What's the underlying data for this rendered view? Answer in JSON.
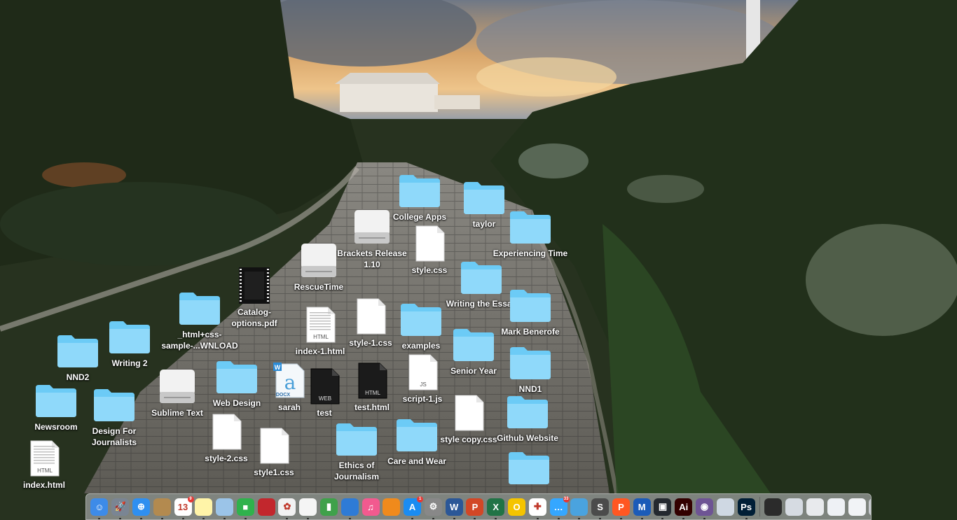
{
  "desktop_icons": [
    {
      "name": "College Apps",
      "kind": "folder"
    },
    {
      "name": "taylor",
      "kind": "folder"
    },
    {
      "name": "Experiencing Time",
      "kind": "folder"
    },
    {
      "name": "Brackets Release 1.10",
      "kind": "drive"
    },
    {
      "name": "style.css",
      "kind": "file"
    },
    {
      "name": "RescueTime",
      "kind": "drive"
    },
    {
      "name": "Writing the Essay",
      "kind": "folder"
    },
    {
      "name": "Catalog-options.pdf",
      "kind": "pdf"
    },
    {
      "name": "_html+css-sample-...WNLOAD",
      "kind": "folder"
    },
    {
      "name": "index-1.html",
      "kind": "html"
    },
    {
      "name": "style-1.css",
      "kind": "file"
    },
    {
      "name": "examples",
      "kind": "folder"
    },
    {
      "name": "Mark Benerofe",
      "kind": "folder"
    },
    {
      "name": "Writing 2",
      "kind": "folder"
    },
    {
      "name": "NND2",
      "kind": "folder"
    },
    {
      "name": "Senior Year",
      "kind": "folder"
    },
    {
      "name": "Web Design",
      "kind": "folder"
    },
    {
      "name": "sarah",
      "kind": "docx"
    },
    {
      "name": "test",
      "kind": "web"
    },
    {
      "name": "test.html",
      "kind": "htmldark"
    },
    {
      "name": "script-1.js",
      "kind": "js"
    },
    {
      "name": "NND1",
      "kind": "folder"
    },
    {
      "name": "Sublime Text",
      "kind": "drive"
    },
    {
      "name": "Newsroom",
      "kind": "folder"
    },
    {
      "name": "Design For Journalists",
      "kind": "folder"
    },
    {
      "name": "style copy.css",
      "kind": "file"
    },
    {
      "name": "Github Website",
      "kind": "folder"
    },
    {
      "name": "style-2.css",
      "kind": "file"
    },
    {
      "name": "style1.css",
      "kind": "file"
    },
    {
      "name": "Ethics of Journalism",
      "kind": "folder"
    },
    {
      "name": "Care and Wear",
      "kind": "folder"
    },
    {
      "name": "index.html",
      "kind": "html"
    },
    {
      "name": "",
      "kind": "folder"
    }
  ],
  "file_badges": {
    "html": "HTML",
    "js": "JS",
    "web": "WEB",
    "docx": "DOCX",
    "docx_letter": "W"
  },
  "dock": {
    "apps": [
      {
        "name": "finder",
        "color": "#3d8be8",
        "glyph": "☺"
      },
      {
        "name": "launchpad",
        "color": "#7a8593",
        "glyph": "🚀"
      },
      {
        "name": "safari",
        "color": "#2f8ff0",
        "glyph": "⊕"
      },
      {
        "name": "contacts",
        "color": "#b38a4f",
        "glyph": ""
      },
      {
        "name": "calendar",
        "color": "#ffffff",
        "glyph": "13",
        "badge": "9"
      },
      {
        "name": "notes",
        "color": "#fff4a8",
        "glyph": ""
      },
      {
        "name": "preview",
        "color": "#9bc4e8",
        "glyph": ""
      },
      {
        "name": "facetime",
        "color": "#2fb24c",
        "glyph": "■"
      },
      {
        "name": "photo-booth",
        "color": "#c2272d",
        "glyph": ""
      },
      {
        "name": "photos",
        "color": "#f2f2f2",
        "glyph": "✿"
      },
      {
        "name": "textedit",
        "color": "#f5f5f5",
        "glyph": ""
      },
      {
        "name": "numbers",
        "color": "#3fa14a",
        "glyph": "▮"
      },
      {
        "name": "keynote",
        "color": "#2e7bd6",
        "glyph": ""
      },
      {
        "name": "itunes",
        "color": "#f25a8f",
        "glyph": "♫"
      },
      {
        "name": "ibooks",
        "color": "#f08a1c",
        "glyph": ""
      },
      {
        "name": "app-store",
        "color": "#1a8cf2",
        "glyph": "A",
        "badge": "1"
      },
      {
        "name": "system-preferences",
        "color": "#888888",
        "glyph": "⚙"
      },
      {
        "name": "word",
        "color": "#2b5797",
        "glyph": "W"
      },
      {
        "name": "powerpoint",
        "color": "#d24726",
        "glyph": "P"
      },
      {
        "name": "excel",
        "color": "#217346",
        "glyph": "X"
      },
      {
        "name": "norton",
        "color": "#f5c400",
        "glyph": "O"
      },
      {
        "name": "first-aid",
        "color": "#ffffff",
        "glyph": "✚"
      },
      {
        "name": "messages",
        "color": "#35a7ff",
        "glyph": "…",
        "badge": "33"
      },
      {
        "name": "network",
        "color": "#4aa3df",
        "glyph": ""
      },
      {
        "name": "sublime-text",
        "color": "#4b4b4b",
        "glyph": "S"
      },
      {
        "name": "pages-p",
        "color": "#ff5722",
        "glyph": "P"
      },
      {
        "name": "malwarebytes",
        "color": "#1b5bb8",
        "glyph": "M"
      },
      {
        "name": "brackets",
        "color": "#24292f",
        "glyph": "▣"
      },
      {
        "name": "illustrator",
        "color": "#330000",
        "glyph": "Ai"
      },
      {
        "name": "github-desktop",
        "color": "#6e5494",
        "glyph": "◉"
      },
      {
        "name": "image-capture",
        "color": "#cfd8e3",
        "glyph": ""
      },
      {
        "name": "photoshop",
        "color": "#001e36",
        "glyph": "Ps"
      },
      {
        "name": "terminal",
        "color": "#2b2b2b",
        "glyph": ""
      },
      {
        "name": "screenshot-1",
        "color": "#d6dbe2",
        "glyph": ""
      },
      {
        "name": "screenshot-2",
        "color": "#e8eaed",
        "glyph": ""
      },
      {
        "name": "screenshot-3",
        "color": "#eef1f5",
        "glyph": ""
      },
      {
        "name": "screenshot-4",
        "color": "#f1f3f6",
        "glyph": ""
      },
      {
        "name": "trash",
        "color": "#c9ccd1",
        "glyph": "🗑"
      }
    ]
  },
  "colors": {
    "folder": "#6ccbf6",
    "folder_tab": "#8fd9fa",
    "accent": "#3d8be8"
  }
}
